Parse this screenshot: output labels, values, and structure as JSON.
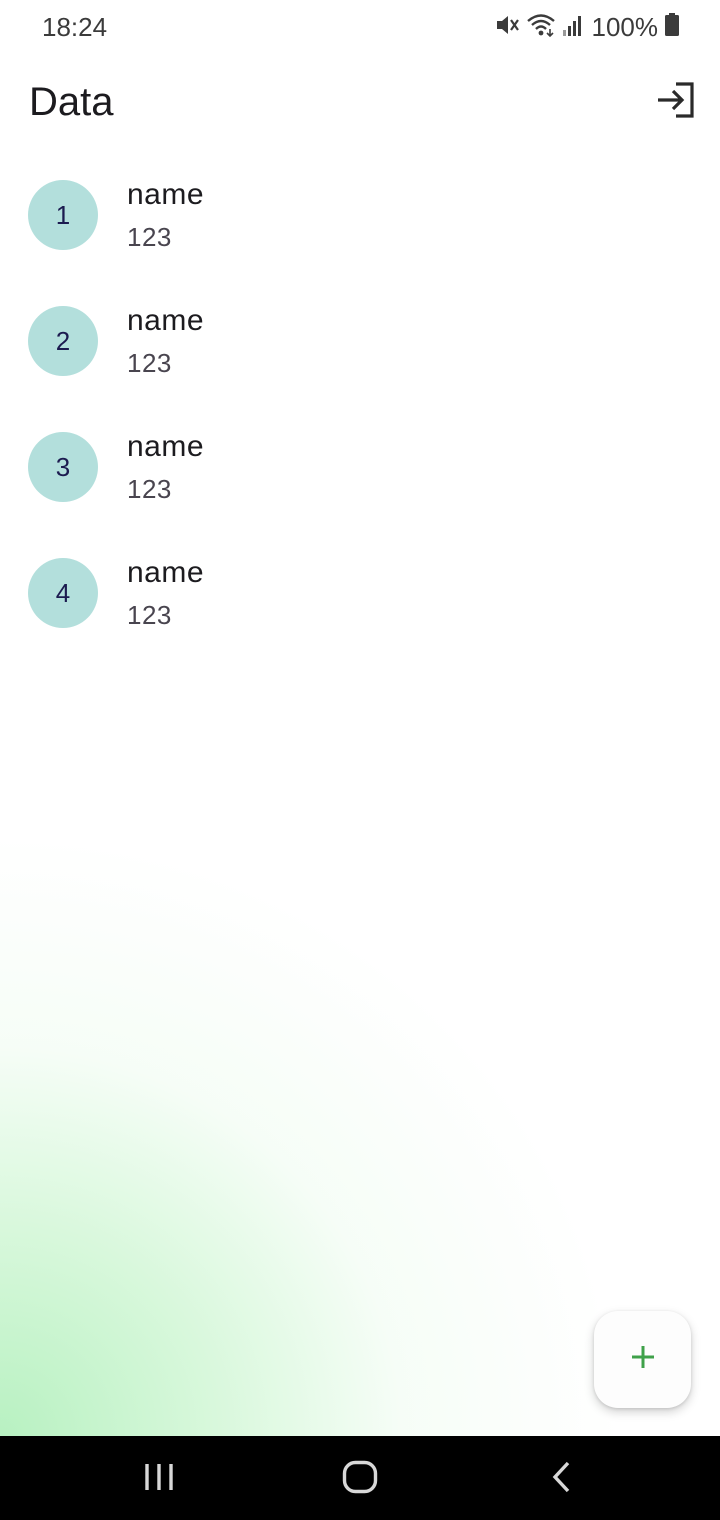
{
  "status_bar": {
    "time": "18:24",
    "battery_percent": "100%",
    "icons": [
      "mute-icon",
      "wifi-icon",
      "signal-icon",
      "battery-icon"
    ]
  },
  "app_bar": {
    "title": "Data",
    "action_icon": "login-icon"
  },
  "list": {
    "items": [
      {
        "avatar": "1",
        "title": "name",
        "subtitle": "123"
      },
      {
        "avatar": "2",
        "title": "name",
        "subtitle": "123"
      },
      {
        "avatar": "3",
        "title": "name",
        "subtitle": "123"
      },
      {
        "avatar": "4",
        "title": "name",
        "subtitle": "123"
      }
    ]
  },
  "fab": {
    "icon": "plus-icon"
  },
  "nav_bar": {
    "icons": [
      "recents-icon",
      "home-icon",
      "back-icon"
    ]
  },
  "colors": {
    "avatar_bg": "#b3dfdc",
    "fab_icon": "#3fa14a",
    "gradient": "#b4f0be"
  }
}
